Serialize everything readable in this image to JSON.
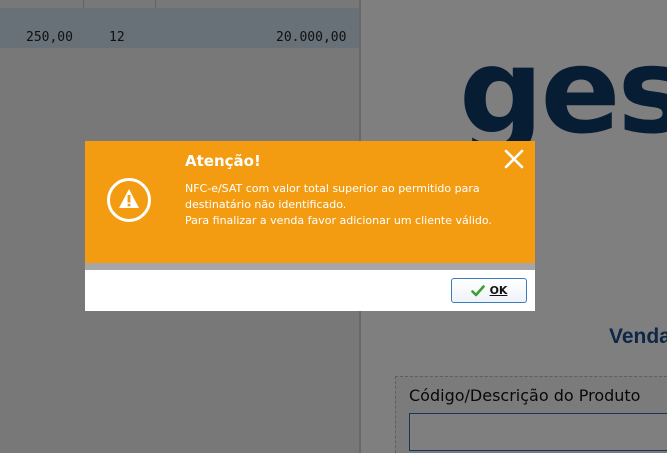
{
  "background": {
    "grid": {
      "row": {
        "price": "250,00",
        "quantity": "12",
        "total": "20.000,00"
      }
    },
    "logo_text": "ges",
    "section_title": "Venda",
    "product_field": {
      "label": "Código/Descrição do Produto",
      "value": ""
    }
  },
  "dialog": {
    "title": "Atenção!",
    "message_lines": [
      "NFC-e/SAT com valor total superior ao permitido para",
      "destinatário não identificado.",
      "Para finalizar a venda favor adicionar um cliente válido."
    ],
    "ok_label": "OK",
    "icons": {
      "warning": "warning-icon",
      "close": "close-icon",
      "ok": "check-icon"
    }
  },
  "colors": {
    "dialog_header": "#f39c12",
    "dialog_text": "#ffffff",
    "ok_check": "#3aa032",
    "logo": "#0f3a66",
    "section_title": "#1f4e8c",
    "grid_row": "#cfe3ef"
  }
}
